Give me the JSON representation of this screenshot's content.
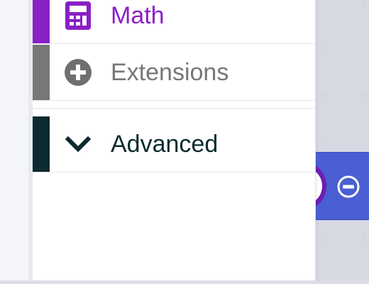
{
  "toolbox": {
    "categories": [
      {
        "label": "Math",
        "icon": "calculator-icon",
        "color": "#8a1fc6",
        "text_color": "#8a1fc6"
      },
      {
        "label": "Extensions",
        "icon": "plus-circle-icon",
        "color": "#777777",
        "text_color": "#777777"
      },
      {
        "label": "Advanced",
        "icon": "chevron-down-icon",
        "color": "#0c2a2f",
        "text_color": "#0c2a2f"
      }
    ]
  },
  "workspace": {
    "block": {
      "color": "#4a5fd2",
      "ring_color": "#6c1fb1",
      "remove_icon": "minus-circle-icon"
    }
  }
}
